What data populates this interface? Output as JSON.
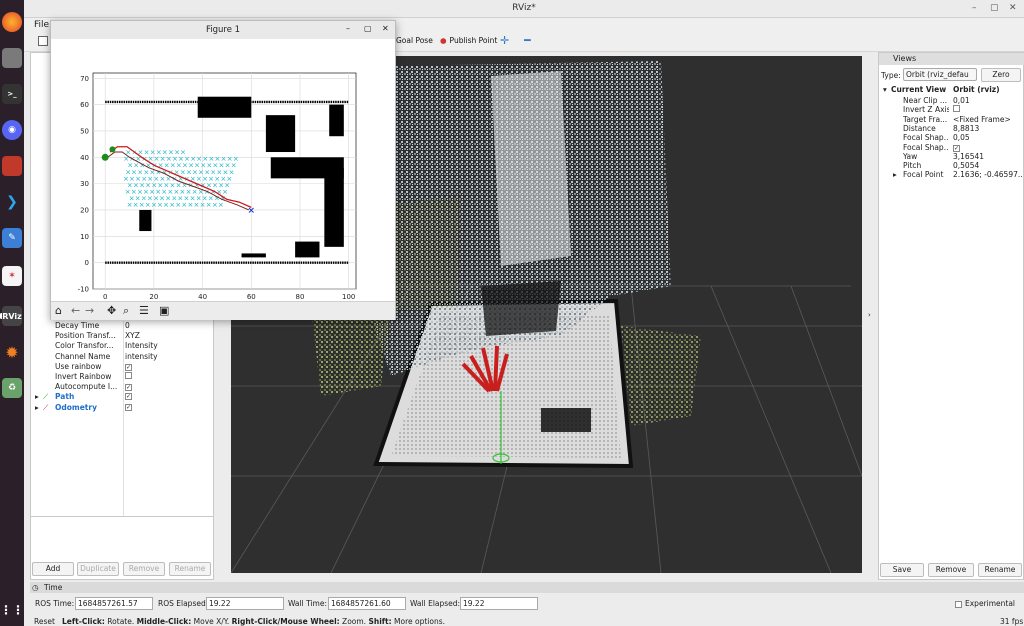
{
  "window": {
    "title": "RViz*"
  },
  "menubar": {
    "file": "File"
  },
  "toolbar": {
    "goal_pose": "Goal Pose",
    "publish_point": "Publish Point"
  },
  "display_props": [
    {
      "label": "Decay Time",
      "value": "0"
    },
    {
      "label": "Position Transf...",
      "value": "XYZ"
    },
    {
      "label": "Color Transfor...",
      "value": "Intensity"
    },
    {
      "label": "Channel Name",
      "value": "intensity"
    },
    {
      "label": "Use rainbow",
      "value": "",
      "checked": true
    },
    {
      "label": "Invert Rainbow",
      "value": "",
      "checked": false
    },
    {
      "label": "Autocompute I...",
      "value": "",
      "checked": true
    }
  ],
  "displays": [
    {
      "label": "Path",
      "color": "#1e6fc9",
      "checked": true
    },
    {
      "label": "Odometry",
      "color": "#1e6fc9",
      "checked": true
    }
  ],
  "display_buttons": {
    "add": "Add",
    "duplicate": "Duplicate",
    "remove": "Remove",
    "rename": "Rename"
  },
  "views": {
    "title": "Views",
    "type_label": "Type:",
    "type_value": "Orbit (rviz_defau",
    "zero": "Zero",
    "current_view": "Current View",
    "current_view_type": "Orbit (rviz)",
    "rows": [
      {
        "label": "Near Clip ...",
        "value": "0,01"
      },
      {
        "label": "Invert Z Axis",
        "value": "",
        "checked": false
      },
      {
        "label": "Target Fra...",
        "value": "<Fixed Frame>"
      },
      {
        "label": "Distance",
        "value": "8,8813"
      },
      {
        "label": "Focal Shap...",
        "value": "0,05"
      },
      {
        "label": "Focal Shap...",
        "value": "",
        "checked": true
      },
      {
        "label": "Yaw",
        "value": "3,16541"
      },
      {
        "label": "Pitch",
        "value": "0,5054"
      },
      {
        "label": "Focal Point",
        "value": "2.1636; -0.46597..."
      }
    ],
    "save": "Save",
    "remove": "Remove",
    "rename": "Rename"
  },
  "time": {
    "title": "Time",
    "ros_time_label": "ROS Time:",
    "ros_time": "1684857261.57",
    "ros_elapsed_label": "ROS Elapsed:",
    "ros_elapsed": "19.22",
    "wall_time_label": "Wall Time:",
    "wall_time": "1684857261.60",
    "wall_elapsed_label": "Wall Elapsed:",
    "wall_elapsed": "19.22",
    "experimental": "Experimental"
  },
  "status": {
    "reset": "Reset",
    "help_bold1": "Left-Click:",
    "help1": " Rotate. ",
    "help_bold2": "Middle-Click:",
    "help2": " Move X/Y. ",
    "help_bold3": "Right-Click/Mouse Wheel:",
    "help3": " Zoom. ",
    "help_bold4": "Shift:",
    "help4": " More options.",
    "fps": "31 fps"
  },
  "figure": {
    "title": "Figure 1"
  },
  "chart_data": {
    "type": "scatter",
    "xlim": [
      -5,
      103
    ],
    "ylim": [
      -10,
      72
    ],
    "xticks": [
      "0",
      "20",
      "40",
      "60",
      "80",
      "100"
    ],
    "xtick_values": [
      0,
      20,
      40,
      60,
      80,
      100
    ],
    "yticks": [
      "-10",
      "0",
      "10",
      "20",
      "30",
      "40",
      "50",
      "60",
      "70"
    ],
    "ytick_values": [
      -10,
      0,
      10,
      20,
      30,
      40,
      50,
      60,
      70
    ],
    "grid": true,
    "start": [
      0,
      40
    ],
    "goal": [
      60,
      20
    ],
    "path": [
      [
        2,
        42
      ],
      [
        5,
        44
      ],
      [
        9,
        44
      ],
      [
        12,
        42
      ],
      [
        15,
        40
      ],
      [
        20,
        37
      ],
      [
        25,
        35
      ],
      [
        30,
        33
      ],
      [
        35,
        31
      ],
      [
        40,
        29
      ],
      [
        45,
        27
      ],
      [
        50,
        24
      ],
      [
        55,
        23
      ],
      [
        60,
        21
      ]
    ],
    "path_alt": [
      [
        1,
        40
      ],
      [
        4,
        42
      ],
      [
        7,
        42
      ],
      [
        10,
        40
      ],
      [
        14,
        38
      ],
      [
        18,
        36
      ],
      [
        24,
        34
      ],
      [
        30,
        31
      ],
      [
        36,
        29
      ],
      [
        42,
        27
      ],
      [
        48,
        24
      ],
      [
        54,
        22
      ],
      [
        59,
        20
      ]
    ],
    "obstacles_lines": [
      {
        "y": 61,
        "x0": 0,
        "x1": 100
      },
      {
        "y": 0,
        "x0": 0,
        "x1": 100
      }
    ]
  }
}
